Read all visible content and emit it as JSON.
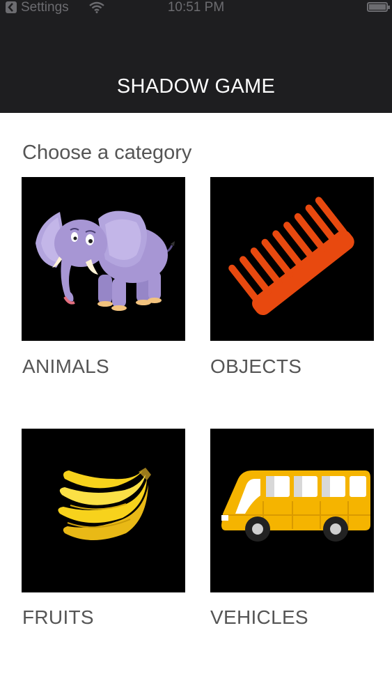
{
  "status_bar": {
    "carrier": "Settings",
    "time": "10:51 PM"
  },
  "nav": {
    "title": "SHADOW GAME"
  },
  "subtitle": "Choose a category",
  "categories": [
    {
      "label": "ANIMALS",
      "icon": "elephant-icon"
    },
    {
      "label": "OBJECTS",
      "icon": "comb-icon"
    },
    {
      "label": "FRUITS",
      "icon": "banana-icon"
    },
    {
      "label": "VEHICLES",
      "icon": "bus-icon"
    }
  ],
  "colors": {
    "nav_bg": "#1e1e20",
    "tile_bg": "#000000",
    "comb": "#e8490f",
    "bus": "#f5b400",
    "banana": "#f7d21c",
    "elephant": "#a796d4"
  }
}
